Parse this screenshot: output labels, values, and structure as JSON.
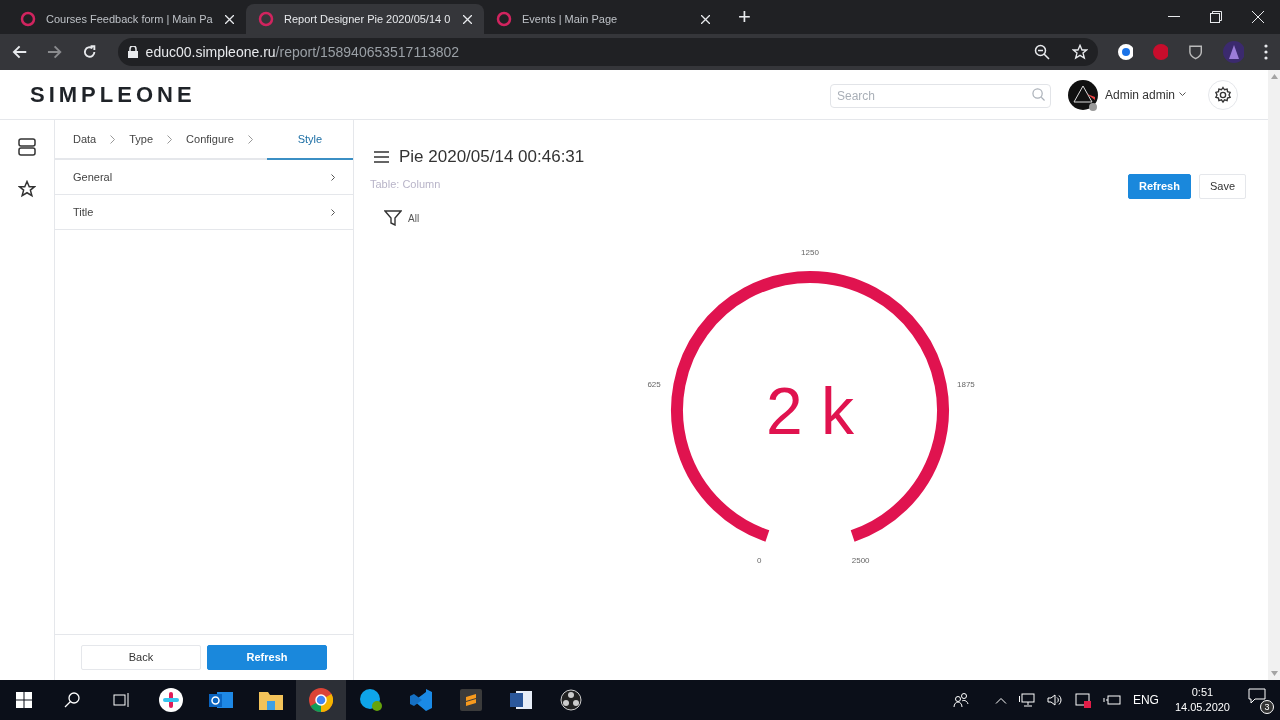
{
  "browser": {
    "tabs": [
      {
        "title": "Courses Feedback form | Main Pa",
        "selected": false
      },
      {
        "title": "Report Designer Pie 2020/05/14 0",
        "selected": true
      },
      {
        "title": "Events | Main Page",
        "selected": false
      }
    ],
    "new_tab": "+",
    "url_host": "educ00.simpleone.ru",
    "url_path": "/report/158940653517113802"
  },
  "header": {
    "logo": "SIMPLEONE",
    "search": {
      "placeholder": "Search"
    },
    "user": "Admin admin"
  },
  "designer": {
    "steps": [
      {
        "label": "Data",
        "selected": false
      },
      {
        "label": "Type",
        "selected": false
      },
      {
        "label": "Configure",
        "selected": false
      },
      {
        "label": "Style",
        "selected": true
      }
    ],
    "sections": [
      "General",
      "Title"
    ],
    "buttons": [
      {
        "label": "Back",
        "kind": "secondary"
      },
      {
        "label": "Refresh",
        "kind": "primary"
      }
    ]
  },
  "report": {
    "title": "Pie 2020/05/14 00:46:31",
    "table": "Table: Column",
    "filter": "All",
    "buttons": [
      {
        "label": "Refresh",
        "kind": "primary"
      },
      {
        "label": "Save",
        "kind": "secondary"
      }
    ],
    "gauge": {
      "value": "2 k",
      "ticks": [
        "0",
        "625",
        "1250",
        "1875",
        "2500"
      ]
    }
  },
  "taskbar": {
    "language": "ENG",
    "time": "0:51",
    "date": "14.05.2020",
    "notifications": "3"
  }
}
